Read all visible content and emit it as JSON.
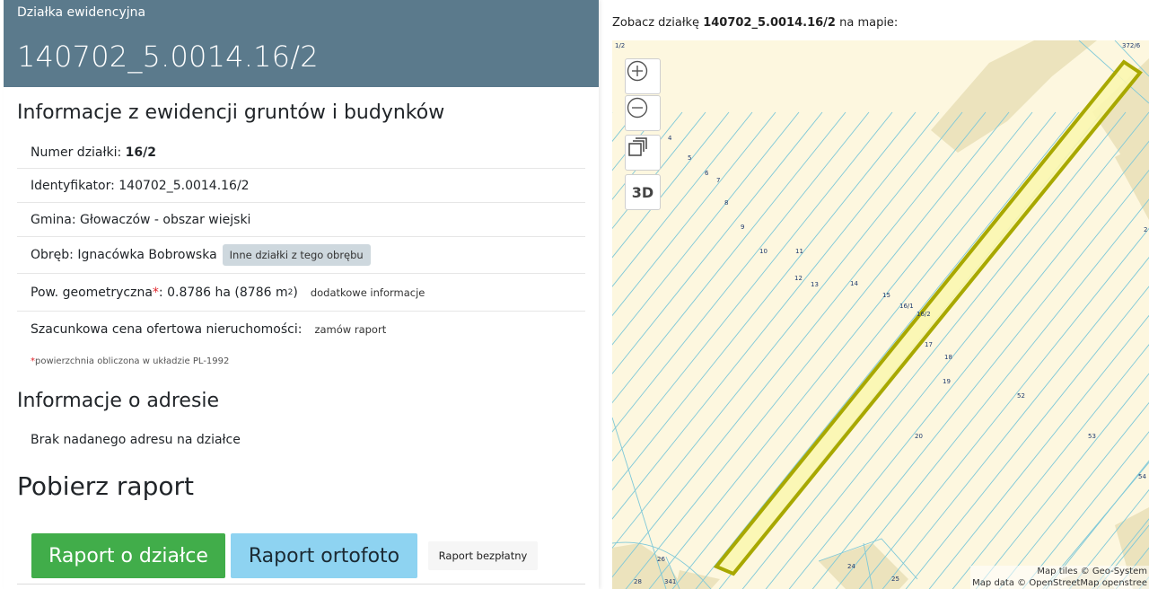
{
  "header": {
    "section_label": "Działka ewidencyjna",
    "parcel_id": "140702_5.0014.16/2"
  },
  "egib": {
    "title": "Informacje z ewidencji gruntów i budynków",
    "numer_label": "Numer działki: ",
    "numer_value": "16/2",
    "identyfikator": "Identyfikator: 140702_5.0014.16/2",
    "gmina": "Gmina: Głowaczów - obszar wiejski",
    "obreb": "Obręb: Ignacówka Bobrowska",
    "obreb_button": "Inne działki z tego obrębu",
    "pow_label": "Pow. geometryczna",
    "pow_star": "*",
    "pow_value_a": ": 0.8786 ha (8786 m",
    "pow_sup": "2",
    "pow_value_b": ")",
    "pow_button": "dodatkowe informacje",
    "cena_label": "Szacunkowa cena ofertowa nieruchomości:",
    "cena_button": "zamów raport",
    "note_star": "*",
    "note_text": "powierzchnia obliczona w układzie PL-1992"
  },
  "address": {
    "title": "Informacje o adresie",
    "text": "Brak nadanego adresu na działce"
  },
  "report": {
    "title": "Pobierz raport",
    "btn_parcel": "Raport o działce",
    "btn_ortho": "Raport ortofoto",
    "btn_free": "Raport bezpłatny"
  },
  "map": {
    "caption_prefix": "Zobacz działkę ",
    "caption_parcel": "140702_5.0014.16/2",
    "caption_suffix": " na mapie:",
    "btn_3d": "3D",
    "attribution_1": "Map tiles © Geo-System",
    "attribution_2": "Map data © OpenStreetMap openstree",
    "labels": [
      "1/2",
      "372/6",
      "4",
      "5",
      "6",
      "7",
      "8",
      "9",
      "10",
      "11",
      "12",
      "13",
      "14",
      "15",
      "16/1",
      "16/2",
      "17",
      "18",
      "19",
      "20",
      "52",
      "53",
      "54",
      "2",
      "26",
      "28",
      "341",
      "24",
      "25"
    ],
    "colors": {
      "background": "#fdf7df",
      "lines": "#7ec8d8",
      "vegetation": "#ece3bd",
      "highlight_fill": "#fbf6b0",
      "highlight_stroke": "#a8a800"
    }
  }
}
